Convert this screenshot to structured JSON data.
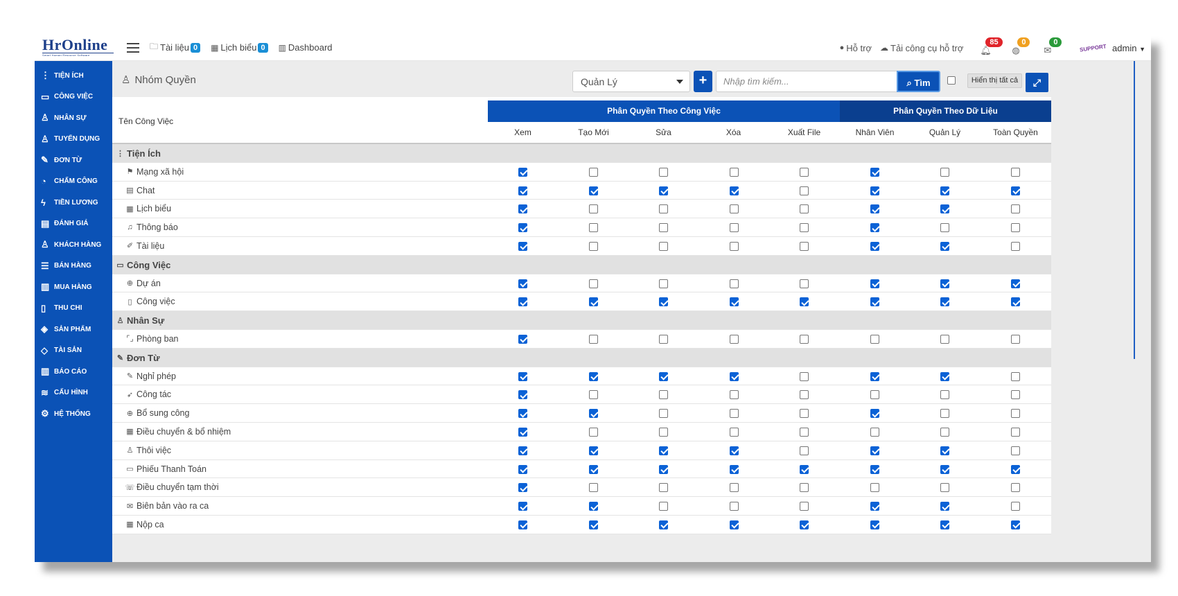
{
  "app": {
    "logo_text": "HrOnline",
    "logo_sub": "Smart Human Resource Software"
  },
  "topbar": {
    "links": [
      {
        "label": "Tài liệu",
        "icon": "folder-icon",
        "count": "0"
      },
      {
        "label": "Lịch biểu",
        "icon": "calendar-icon",
        "count": "0"
      },
      {
        "label": "Dashboard",
        "icon": "bar-chart-icon"
      }
    ],
    "support_label": "Hỗ trợ",
    "download_tool_label": "Tải công cụ hỗ trợ",
    "notifications": [
      {
        "icon": "bell-icon",
        "count": "85",
        "color": "#e0242a"
      },
      {
        "icon": "globe-icon",
        "count": "0",
        "color": "#f0a020"
      },
      {
        "icon": "mail-icon",
        "count": "0",
        "color": "#2a9a3a"
      }
    ],
    "support_logo_text": "SUPPORT",
    "user_name": "admin"
  },
  "sidebar": {
    "items": [
      {
        "label": "TIỆN ÍCH",
        "icon": "dots-vertical-icon"
      },
      {
        "label": "CÔNG VIỆC",
        "icon": "inbox-icon"
      },
      {
        "label": "NHÂN SỰ",
        "icon": "user-icon"
      },
      {
        "label": "TUYỂN DỤNG",
        "icon": "user-icon"
      },
      {
        "label": "ĐƠN TỪ",
        "icon": "edit-icon"
      },
      {
        "label": "CHẤM CÔNG",
        "icon": "gauge-icon"
      },
      {
        "label": "TIỀN LƯƠNG",
        "icon": "bolt-icon"
      },
      {
        "label": "ĐÁNH GIÁ",
        "icon": "book-icon"
      },
      {
        "label": "KHÁCH HÀNG",
        "icon": "user-icon"
      },
      {
        "label": "BÁN HÀNG",
        "icon": "menu-icon"
      },
      {
        "label": "MUA HÀNG",
        "icon": "map-icon"
      },
      {
        "label": "THU CHI",
        "icon": "file-icon"
      },
      {
        "label": "SẢN PHẨM",
        "icon": "tag-icon"
      },
      {
        "label": "TÀI SẢN",
        "icon": "diamond-icon"
      },
      {
        "label": "BÁO CÁO",
        "icon": "bar-chart-icon"
      },
      {
        "label": "CẤU HÌNH",
        "icon": "layers-icon"
      },
      {
        "label": "HỆ THỐNG",
        "icon": "gear-icon"
      }
    ]
  },
  "page": {
    "title": "Nhóm Quyền",
    "select_value": "Quản Lý",
    "search_placeholder": "Nhập tìm kiếm...",
    "search_button": "Tìm",
    "show_all_label": "Hiển thị tất cả"
  },
  "table": {
    "task_header": "Tên Công Việc",
    "group_task": "Phân Quyền Theo Công Việc",
    "group_data": "Phân Quyền Theo Dữ Liệu",
    "columns": [
      "Xem",
      "Tạo Mới",
      "Sửa",
      "Xóa",
      "Xuất File",
      "Nhân Viên",
      "Quản Lý",
      "Toàn Quyền"
    ],
    "rows": [
      {
        "type": "section",
        "label": "Tiện Ích",
        "icon": "dots-vertical-icon"
      },
      {
        "type": "item",
        "label": "Mạng xã hội",
        "icon": "flag-icon",
        "checks": [
          1,
          0,
          0,
          0,
          0,
          1,
          0,
          0
        ]
      },
      {
        "type": "item",
        "label": "Chat",
        "icon": "chat-icon",
        "checks": [
          1,
          1,
          1,
          1,
          0,
          1,
          1,
          1
        ]
      },
      {
        "type": "item",
        "label": "Lịch biểu",
        "icon": "calendar-icon",
        "checks": [
          1,
          0,
          0,
          0,
          0,
          1,
          1,
          0
        ]
      },
      {
        "type": "item",
        "label": "Thông báo",
        "icon": "bell-icon",
        "checks": [
          1,
          0,
          0,
          0,
          0,
          1,
          0,
          0
        ]
      },
      {
        "type": "item",
        "label": "Tài liệu",
        "icon": "pencil-icon",
        "checks": [
          1,
          0,
          0,
          0,
          0,
          1,
          1,
          0
        ]
      },
      {
        "type": "section",
        "label": "Công Việc",
        "icon": "inbox-icon"
      },
      {
        "type": "item",
        "label": "Dự án",
        "icon": "crosshair-icon",
        "checks": [
          1,
          0,
          0,
          0,
          0,
          1,
          1,
          1
        ]
      },
      {
        "type": "item",
        "label": "Công việc",
        "icon": "book-icon",
        "checks": [
          1,
          1,
          1,
          1,
          1,
          1,
          1,
          1
        ]
      },
      {
        "type": "section",
        "label": "Nhân Sự",
        "icon": "user-icon"
      },
      {
        "type": "item",
        "label": "Phòng ban",
        "icon": "bracket-icon",
        "checks": [
          1,
          0,
          0,
          0,
          0,
          0,
          0,
          0
        ]
      },
      {
        "type": "section",
        "label": "Đơn Từ",
        "icon": "edit-icon"
      },
      {
        "type": "item",
        "label": "Nghỉ phép",
        "icon": "edit-icon",
        "checks": [
          1,
          1,
          1,
          1,
          0,
          1,
          1,
          0
        ]
      },
      {
        "type": "item",
        "label": "Công tác",
        "icon": "rocket-icon",
        "checks": [
          1,
          0,
          0,
          0,
          0,
          0,
          0,
          0
        ]
      },
      {
        "type": "item",
        "label": "Bổ sung công",
        "icon": "plus-circle-icon",
        "checks": [
          1,
          1,
          0,
          0,
          0,
          1,
          0,
          0
        ]
      },
      {
        "type": "item",
        "label": "Điều chuyển & bổ nhiệm",
        "icon": "grid-icon",
        "checks": [
          1,
          0,
          0,
          0,
          0,
          0,
          0,
          0
        ]
      },
      {
        "type": "item",
        "label": "Thôi việc",
        "icon": "user-icon",
        "checks": [
          1,
          1,
          1,
          1,
          0,
          1,
          1,
          0
        ]
      },
      {
        "type": "item",
        "label": "Phiếu Thanh Toán",
        "icon": "monitor-icon",
        "checks": [
          1,
          1,
          1,
          1,
          1,
          1,
          1,
          1
        ]
      },
      {
        "type": "item",
        "label": "Điều chuyển tạm thời",
        "icon": "phone-icon",
        "checks": [
          1,
          0,
          0,
          0,
          0,
          0,
          0,
          0
        ]
      },
      {
        "type": "item",
        "label": "Biên bản vào ra ca",
        "icon": "mail-icon",
        "checks": [
          1,
          1,
          0,
          0,
          0,
          1,
          1,
          0
        ]
      },
      {
        "type": "item",
        "label": "Nộp ca",
        "icon": "calendar-icon",
        "checks": [
          1,
          1,
          1,
          1,
          1,
          1,
          1,
          1
        ]
      }
    ]
  },
  "colors": {
    "primary": "#0b52b6",
    "group_data_header": "#0a3f8f",
    "section_row": "#e1e1e1",
    "checkbox_checked": "#0b62d6"
  }
}
